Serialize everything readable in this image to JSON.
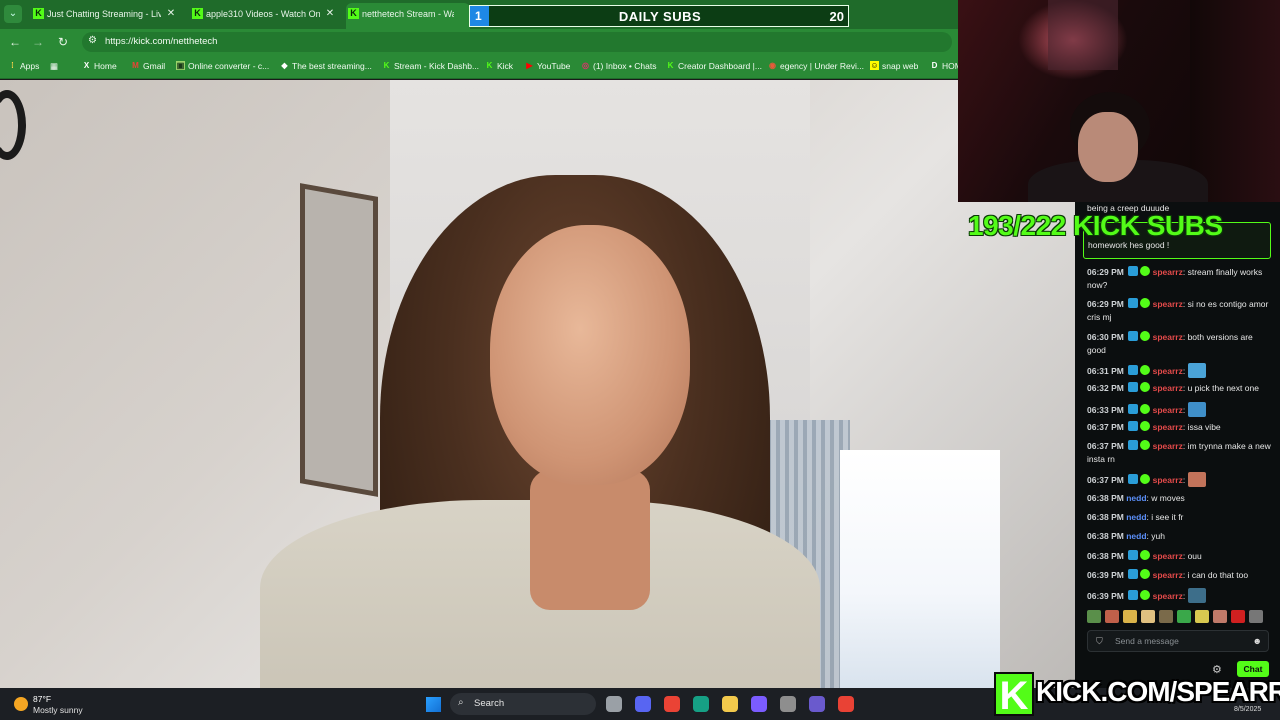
{
  "browser": {
    "tabs": [
      {
        "title": "Just Chatting Streaming - Live S",
        "favicon": "K"
      },
      {
        "title": "apple310 Videos - Watch On-D",
        "favicon": "K"
      },
      {
        "title": "netthetech Stream - Watch Li",
        "favicon": "K"
      }
    ],
    "new_tab": "+",
    "url": "https://kick.com/netthetech",
    "bookmarks": [
      {
        "label": "Apps",
        "icon": "apps-grid-icon"
      },
      {
        "label": "Home",
        "icon": "x-logo-icon"
      },
      {
        "label": "Gmail",
        "icon": "gmail-icon"
      },
      {
        "label": "Online converter - c...",
        "icon": "converter-icon"
      },
      {
        "label": "The best streaming...",
        "icon": "streaming-icon"
      },
      {
        "label": "Stream - Kick Dashb...",
        "icon": "kick-icon"
      },
      {
        "label": "Kick",
        "icon": "kick-icon"
      },
      {
        "label": "YouTube",
        "icon": "youtube-icon"
      },
      {
        "label": "(1) Inbox • Chats",
        "icon": "instagram-icon"
      },
      {
        "label": "Creator Dashboard |...",
        "icon": "kick-icon"
      },
      {
        "label": "egency | Under Revi...",
        "icon": "agency-icon"
      },
      {
        "label": "snap web",
        "icon": "snapchat-icon"
      },
      {
        "label": "HOM",
        "icon": "d-icon"
      }
    ]
  },
  "daily_subs": {
    "label": "DAILY SUBS",
    "current": "1",
    "goal": "20",
    "progress": 0.05
  },
  "kick_subs": "193/222 KICK SUBS",
  "chat": {
    "top_line": "being a creep duuude",
    "highlight": "homework hes good !",
    "messages": [
      {
        "time": "06:29 PM",
        "user": "spearrz",
        "text": "stream finally works now?",
        "color": "red",
        "badges": true
      },
      {
        "time": "06:29 PM",
        "user": "spearrz",
        "text": "si no es contigo amor cris mj",
        "color": "red",
        "badges": true
      },
      {
        "time": "06:30 PM",
        "user": "spearrz",
        "text": "both versions are good",
        "color": "red",
        "badges": true
      },
      {
        "time": "06:31 PM",
        "user": "spearrz",
        "text": "",
        "color": "red",
        "badges": true,
        "emote": "#4aa3d8"
      },
      {
        "time": "06:32 PM",
        "user": "spearrz",
        "text": "u pick the next one",
        "color": "red",
        "badges": true
      },
      {
        "time": "06:33 PM",
        "user": "spearrz",
        "text": "",
        "color": "red",
        "badges": true,
        "emote": "#3f8fc9"
      },
      {
        "time": "06:37 PM",
        "user": "spearrz",
        "text": "issa vibe",
        "color": "red",
        "badges": true
      },
      {
        "time": "06:37 PM",
        "user": "spearrz",
        "text": "im trynna make a new insta rn",
        "color": "red",
        "badges": true
      },
      {
        "time": "06:37 PM",
        "user": "spearrz",
        "text": "",
        "color": "red",
        "badges": true,
        "emote": "#c2735a"
      },
      {
        "time": "06:38 PM",
        "user": "nedd",
        "text": "w moves",
        "color": "blue",
        "badges": false
      },
      {
        "time": "06:38 PM",
        "user": "nedd",
        "text": "i see it fr",
        "color": "blue",
        "badges": false
      },
      {
        "time": "06:38 PM",
        "user": "nedd",
        "text": "yuh",
        "color": "blue",
        "badges": false
      },
      {
        "time": "06:38 PM",
        "user": "spearrz",
        "text": "ouu",
        "color": "red",
        "badges": true
      },
      {
        "time": "06:39 PM",
        "user": "spearrz",
        "text": "i can do that too",
        "color": "red",
        "badges": true
      },
      {
        "time": "06:39 PM",
        "user": "spearrz",
        "text": "",
        "color": "red",
        "badges": true,
        "emote": "#3d6e8a"
      }
    ],
    "emote_bar": [
      "#5a8f4a",
      "#c0604a",
      "#d9b34a",
      "#e0c080",
      "#7a6a4a",
      "#3aa84a",
      "#d8c850",
      "#c07a6a",
      "#d02020",
      "#777"
    ],
    "input_placeholder": "Send a message",
    "chat_button": "Chat"
  },
  "taskbar": {
    "temperature": "87°F",
    "weather": "Mostly sunny",
    "search": "Search",
    "apps": [
      "#9aa0a6",
      "#5865f2",
      "#ea4335",
      "#16a085",
      "#f2c94c",
      "#7b5cff",
      "#8e8e8e",
      "#6a5acd",
      "#e94235"
    ]
  },
  "branding": {
    "k": "K",
    "url": "KICK.COM/SPEARRZ",
    "date": "8/5/2025"
  },
  "colors": {
    "kick_green": "#53fc18",
    "browser_green": "#2a8a36",
    "chat_bg": "#0b0e0f",
    "user_red": "#e34a4a",
    "user_blue": "#5b8ff9"
  }
}
